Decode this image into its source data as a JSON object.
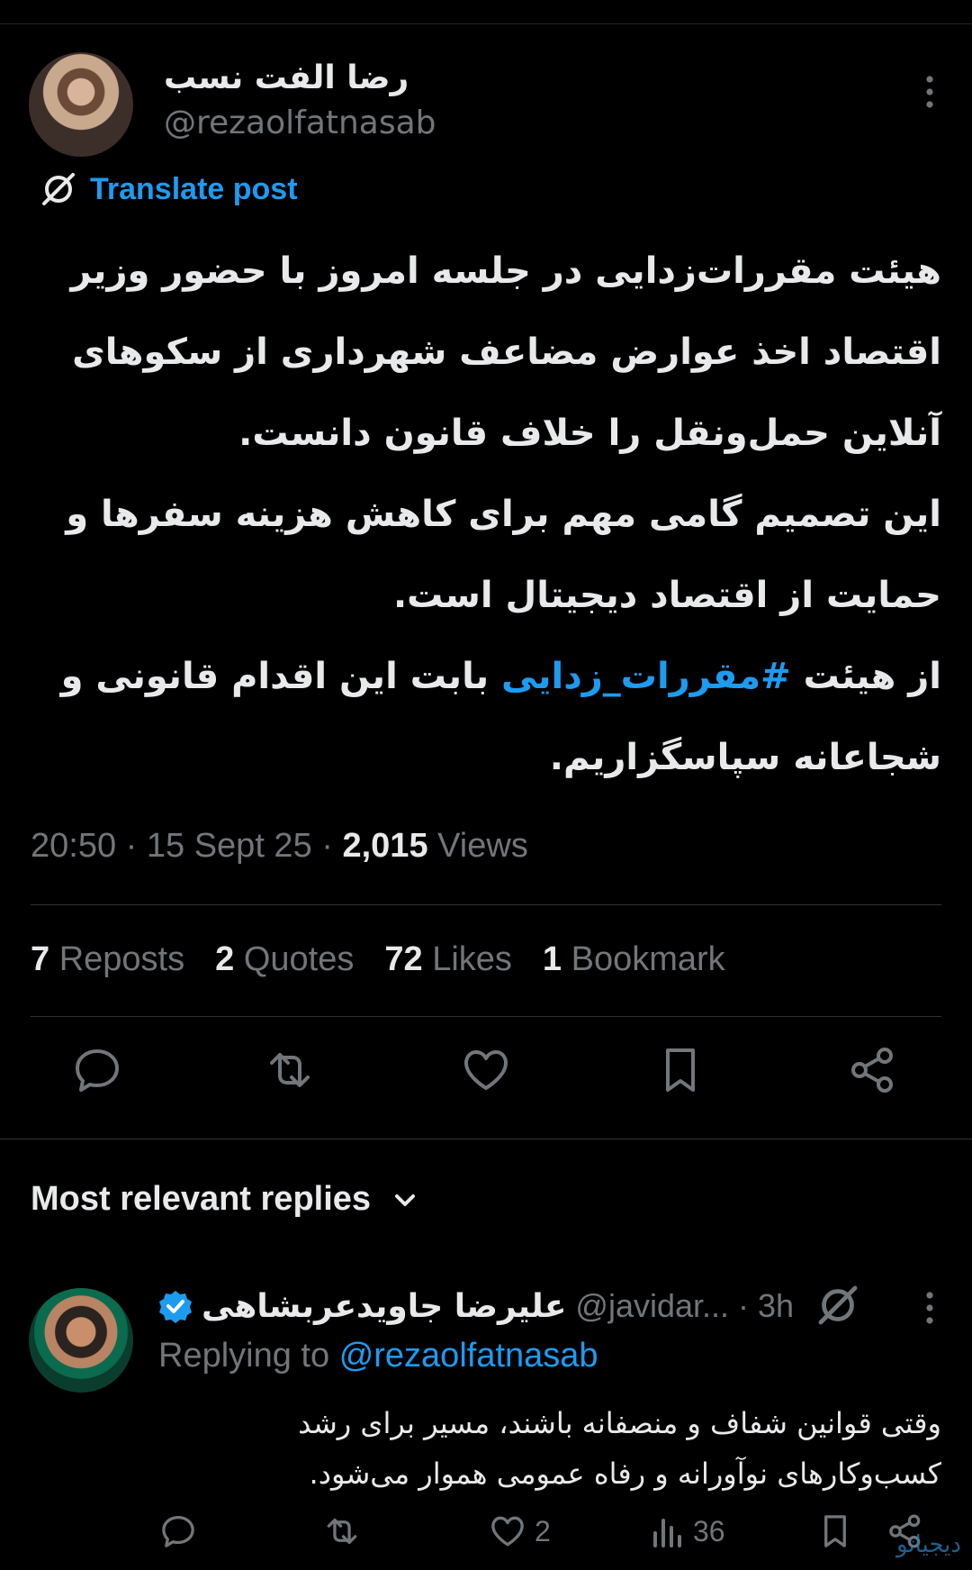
{
  "tweet": {
    "author_name": "رضا الفت نسب",
    "author_handle": "@rezaolfatnasab",
    "translate_label": "Translate post",
    "body_before_hashtag": "هیئت مقررات‌زدایی در جلسه امروز با حضور وزیر اقتصاد اخذ عوارض مضاعف شهرداری از سکوهای آنلاین حمل‌ونقل را خلاف قانون دانست.\nاین تصمیم گامی مهم برای کاهش هزینه سفرها و حمایت از اقتصاد دیجیتال است.\nاز هیئت ",
    "hashtag": "#مقررات_زدایی",
    "body_after_hashtag": " بابت این اقدام قانونی و شجاعانه سپاسگزاریم.",
    "time": "20:50",
    "date": "15 Sept 25",
    "views_count": "2,015",
    "views_label": "Views"
  },
  "stats": {
    "reposts_count": "7",
    "reposts_label": "Reposts",
    "quotes_count": "2",
    "quotes_label": "Quotes",
    "likes_count": "72",
    "likes_label": "Likes",
    "bookmarks_count": "1",
    "bookmarks_label": "Bookmark"
  },
  "replies_header": "Most relevant replies",
  "reply": {
    "author_name": "علیرضا جاویدعربشاهی",
    "author_handle": "@javidar...",
    "time": "· 3h",
    "replying_prefix": "Replying to",
    "replying_to": "@rezaolfatnasab",
    "body": "وقتی قوانین شفاف و منصفانه باشند، مسیر برای رشد کسب‌وکارهای نوآورانه و رفاه عمومی هموار می‌شود.",
    "likes": "2",
    "views": "36"
  },
  "watermark": "دیجیاتو",
  "colors": {
    "accent": "#1d9bf0",
    "muted": "#71767b",
    "text": "#e7e9ea",
    "background": "#000000"
  },
  "icons": [
    "grok-icon",
    "more-icon",
    "reply-icon",
    "repost-icon",
    "like-icon",
    "bookmark-icon",
    "share-icon",
    "chevron-down-icon",
    "verified-badge-icon",
    "views-icon"
  ]
}
